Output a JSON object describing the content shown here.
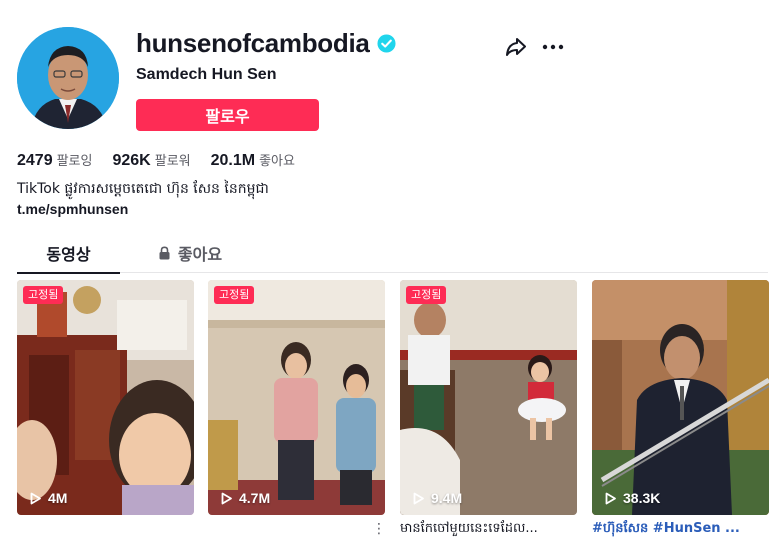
{
  "profile": {
    "username": "hunsenofcambodia",
    "nickname": "Samdech Hun Sen",
    "follow_label": "팔로우",
    "bio": "TikTok ផ្លូវការសម្ដេចតេជោ ហ៊ុន សែន នៃកម្ពុជា",
    "link": "t.me/spmhunsen",
    "verified_icon": "verified-badge-icon",
    "share_icon": "share-icon",
    "more_icon": "more-icon"
  },
  "stats": [
    {
      "value": "2479",
      "label": "팔로잉"
    },
    {
      "value": "926K",
      "label": "팔로워"
    },
    {
      "value": "20.1M",
      "label": "좋아요"
    }
  ],
  "tabs": {
    "videos": "동영상",
    "liked": "좋아요",
    "liked_icon": "lock-icon"
  },
  "videos": [
    {
      "pinned": "고정됨",
      "views": "4M",
      "caption": ""
    },
    {
      "pinned": "고정됨",
      "views": "4.7M",
      "caption": ""
    },
    {
      "pinned": "고정됨",
      "views": "9.4M",
      "caption": "មានកែចៅមួយនេះទេដែល..."
    },
    {
      "pinned": "",
      "views": "38.3K",
      "caption": "#ហ៊ុនសែន #HunSen ..."
    }
  ],
  "caption_more": "⋮",
  "colors": {
    "accent": "#fe2c55",
    "verified": "#20d5ec",
    "hashtag": "#2b5db9",
    "text": "#161823",
    "muted": "#5a5b63"
  }
}
